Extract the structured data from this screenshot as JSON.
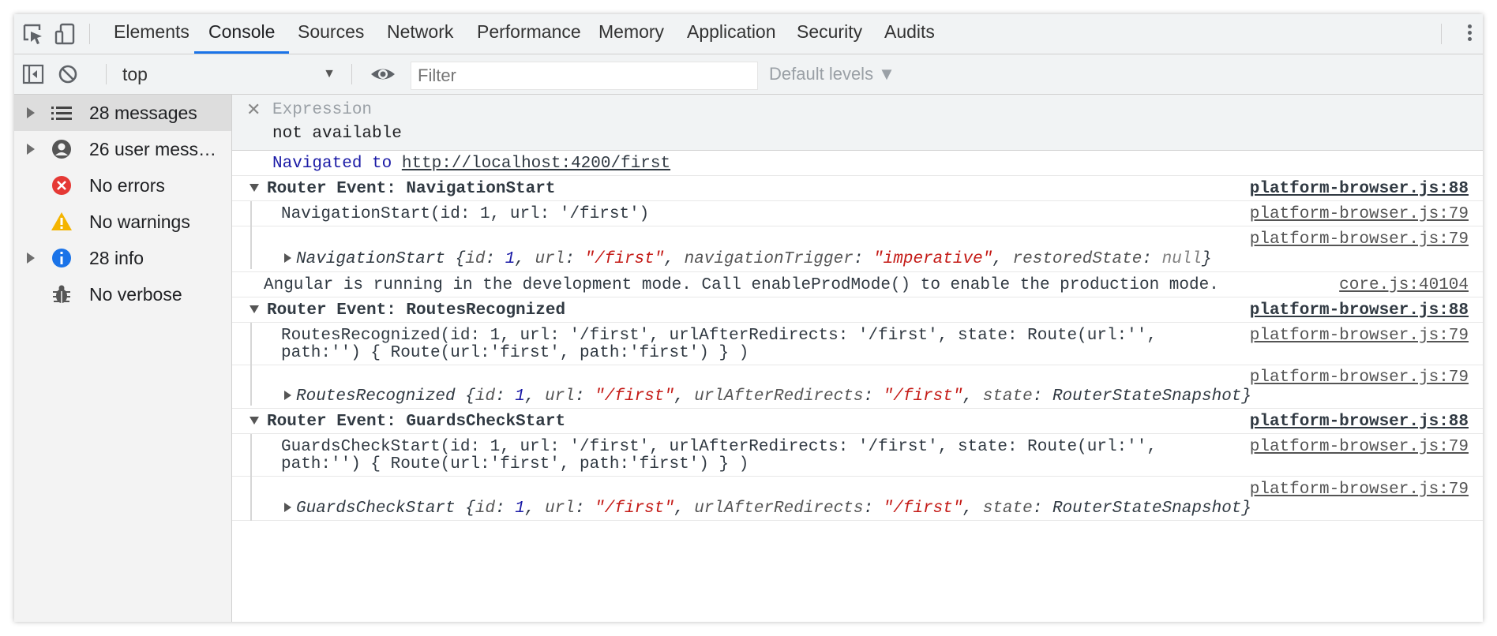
{
  "tabs": [
    "Elements",
    "Console",
    "Sources",
    "Network",
    "Performance",
    "Memory",
    "Application",
    "Security",
    "Audits"
  ],
  "active_tab": "Console",
  "toolbar": {
    "context": "top",
    "filter_placeholder": "Filter",
    "levels": "Default levels ▼"
  },
  "sidebar": {
    "items": [
      {
        "label": "28 messages",
        "icon": "list-icon"
      },
      {
        "label": "26 user mess…",
        "icon": "user-icon"
      },
      {
        "label": "No errors",
        "icon": "error-icon"
      },
      {
        "label": "No warnings",
        "icon": "warning-icon"
      },
      {
        "label": "28 info",
        "icon": "info-icon"
      },
      {
        "label": "No verbose",
        "icon": "bug-icon"
      }
    ]
  },
  "expression": {
    "label": "Expression",
    "value": "not available"
  },
  "console": {
    "navigated_prefix": "Navigated to",
    "navigated_url": "http://localhost:4200/first",
    "groups": [
      {
        "title": "Router Event: NavigationStart",
        "source": "platform-browser.js:88",
        "log": "NavigationStart(id: 1, url: '/first')",
        "log_source": "platform-browser.js:79",
        "obj_source": "platform-browser.js:79",
        "obj_name": "NavigationStart"
      },
      {
        "title": "Router Event: RoutesRecognized",
        "source": "platform-browser.js:88",
        "log_line1": "RoutesRecognized(id: 1, url: '/first', urlAfterRedirects: '/first', state: Route(url:'',",
        "log_line2": "path:'') { Route(url:'first', path:'first') } )",
        "log_source": "platform-browser.js:79",
        "obj_source": "platform-browser.js:79",
        "obj_name": "RoutesRecognized"
      },
      {
        "title": "Router Event: GuardsCheckStart",
        "source": "platform-browser.js:88",
        "log_line1": "GuardsCheckStart(id: 1, url: '/first', urlAfterRedirects: '/first', state: Route(url:'',",
        "log_line2": "path:'') { Route(url:'first', path:'first') } )",
        "log_source": "platform-browser.js:79",
        "obj_source": "platform-browser.js:79",
        "obj_name": "GuardsCheckStart"
      }
    ],
    "angular_msg": "Angular is running in the development mode. Call enableProdMode() to enable the production mode.",
    "angular_source": "core.js:40104",
    "obj": {
      "id_key": "id",
      "id_val": "1",
      "url_key": "url",
      "url_val": "\"/first\"",
      "trigger_key": "navigationTrigger",
      "trigger_val": "\"imperative\"",
      "restored_key": "restoredState",
      "restored_val": "null",
      "redirect_key": "urlAfterRedirects",
      "redirect_val": "\"/first\"",
      "state_key": "state",
      "state_val": "RouterStateSnapshot"
    }
  },
  "colors": {
    "accent": "#1a73e8",
    "string": "#c41a16",
    "number": "#1a1aa6",
    "error": "#e53935",
    "warning": "#f4b400",
    "info": "#1a73e8"
  }
}
